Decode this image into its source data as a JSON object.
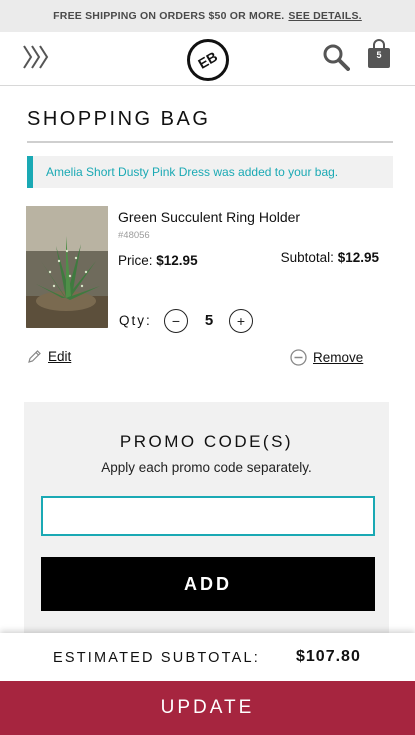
{
  "promo_bar": {
    "text": "FREE SHIPPING ON ORDERS $50 OR MORE.",
    "link": "SEE DETAILS."
  },
  "header": {
    "logo": "EB",
    "bag_count": "5",
    "icons": [
      "menu-chevron-icon",
      "search-icon",
      "shopping-bag-icon"
    ]
  },
  "page_title": "SHOPPING BAG",
  "notice": "Amelia Short Dusty Pink Dress was added to your bag.",
  "item": {
    "name": "Green Succulent Ring Holder",
    "sku": "#48056",
    "price_label": "Price:",
    "price": "$12.95",
    "subtotal_label": "Subtotal:",
    "subtotal": "$12.95",
    "qty_label": "Qty:",
    "qty": "5",
    "edit_label": "Edit",
    "remove_label": "Remove"
  },
  "promo": {
    "title": "PROMO CODE(S)",
    "subtitle": "Apply each promo code separately.",
    "input_value": "",
    "add_label": "ADD"
  },
  "totals": {
    "label": "ESTIMATED SUBTOTAL:",
    "value": "$107.80"
  },
  "update_label": "UPDATE",
  "colors": {
    "accent_teal": "#1aa9b4",
    "update_red": "#a6253f",
    "panel_grey": "#f1f1f1"
  }
}
